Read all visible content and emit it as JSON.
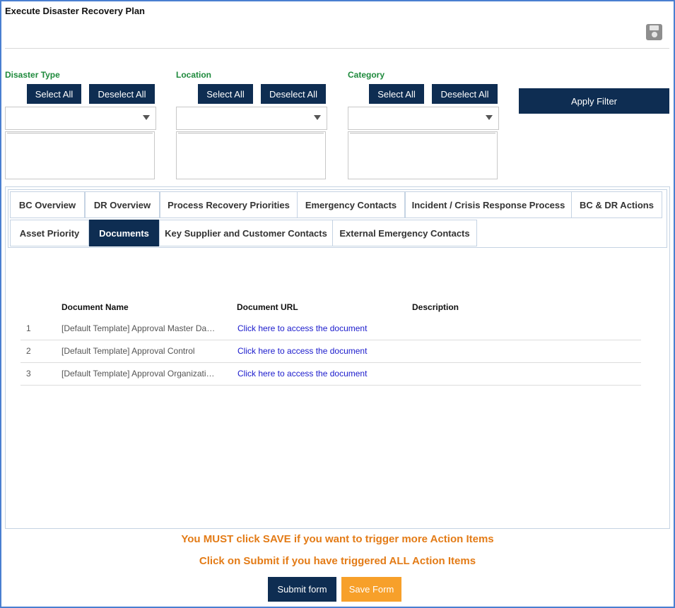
{
  "header": {
    "title": "Execute Disaster Recovery Plan",
    "save_icon": "floppy-disk-icon"
  },
  "filters": [
    {
      "label": "Disaster Type",
      "select_all": "Select All",
      "deselect_all": "Deselect All"
    },
    {
      "label": "Location",
      "select_all": "Select All",
      "deselect_all": "Deselect All"
    },
    {
      "label": "Category",
      "select_all": "Select All",
      "deselect_all": "Deselect All"
    }
  ],
  "apply_filter": "Apply Filter",
  "tabs": [
    {
      "label": "BC Overview"
    },
    {
      "label": "DR Overview"
    },
    {
      "label": "Process Recovery Priorities"
    },
    {
      "label": "Emergency Contacts"
    },
    {
      "label": "Incident / Crisis Response Process"
    },
    {
      "label": "BC & DR Actions"
    },
    {
      "label": "Asset Priority"
    },
    {
      "label": "Documents"
    },
    {
      "label": "Key Supplier and Customer Contacts"
    },
    {
      "label": "External Emergency Contacts"
    }
  ],
  "active_tab": "Documents",
  "table": {
    "columns": [
      "Document Name",
      "Document URL",
      "Description"
    ],
    "rows": [
      {
        "num": "1",
        "name": "[Default Template] Approval Master Da…",
        "url": "Click here to access the document",
        "description": ""
      },
      {
        "num": "2",
        "name": "[Default Template] Approval Control",
        "url": "Click here to access the document",
        "description": ""
      },
      {
        "num": "3",
        "name": "[Default Template] Approval Organizati…",
        "url": "Click here to access the document",
        "description": ""
      }
    ]
  },
  "messages": {
    "line1": "You MUST click SAVE if you want to trigger more Action Items",
    "line2": "Click on Submit if you have triggered ALL Action Items"
  },
  "footer": {
    "submit": "Submit form",
    "save": "Save Form"
  },
  "colors": {
    "primary": "#0e2d52",
    "label_green": "#1e8a3c",
    "warning_orange": "#e37b16",
    "save_orange": "#f7a02a",
    "link_blue": "#1a1acc"
  }
}
